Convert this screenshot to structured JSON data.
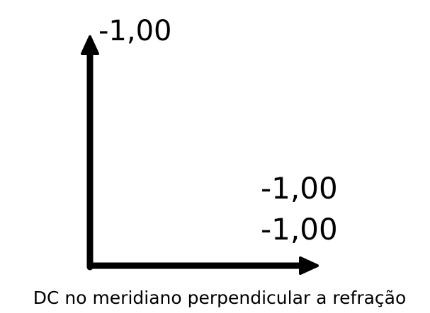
{
  "diagram": {
    "vertical_axis_label": "-1,00",
    "horizontal_axis_label_upper": "-1,00",
    "horizontal_axis_label_lower": "-1,00",
    "caption": "DC no meridiano perpendicular a refração",
    "colors": {
      "stroke": "#000000",
      "text": "#000000",
      "background": "#ffffff"
    }
  }
}
